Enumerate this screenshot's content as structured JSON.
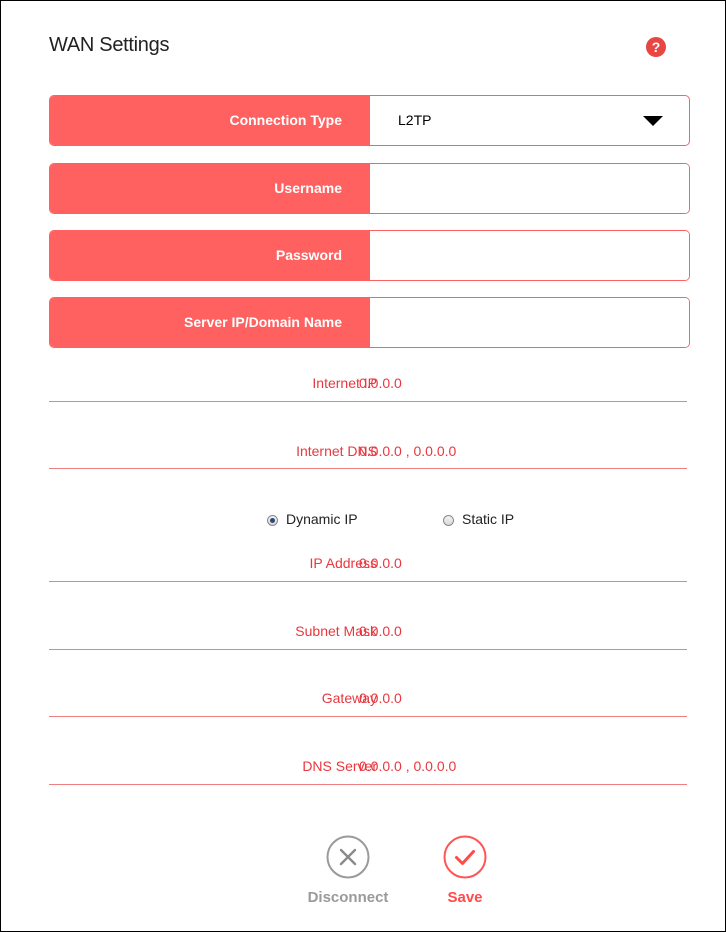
{
  "page": {
    "title": "WAN Settings",
    "help_icon": "question-icon"
  },
  "form": {
    "connection_type": {
      "label": "Connection Type",
      "value": "L2TP"
    },
    "username": {
      "label": "Username",
      "value": ""
    },
    "password": {
      "label": "Password",
      "value": ""
    },
    "server": {
      "label": "Server IP/Domain Name",
      "value": ""
    }
  },
  "status": {
    "internet_ip": {
      "label": "Internet IP",
      "value": "0.0.0.0"
    },
    "internet_dns": {
      "label": "Internet DNS",
      "value": "0.0.0.0 , 0.0.0.0"
    }
  },
  "ip_mode": {
    "dynamic_label": "Dynamic IP",
    "static_label": "Static IP",
    "selected": "Dynamic IP"
  },
  "secondary": {
    "ip_address": {
      "label": "IP Address",
      "value": "0.0.0.0"
    },
    "subnet_mask": {
      "label": "Subnet Mask",
      "value": "0.0.0.0"
    },
    "gateway": {
      "label": "Gateway",
      "value": "0.0.0.0"
    },
    "dns_server": {
      "label": "DNS Server",
      "value": "0.0.0.0 , 0.0.0.0"
    }
  },
  "actions": {
    "disconnect_label": "Disconnect",
    "save_label": "Save"
  },
  "colors": {
    "accent": "#ff6060",
    "label_red": "#e8383f",
    "disabled_gray": "#9a9a9a"
  }
}
